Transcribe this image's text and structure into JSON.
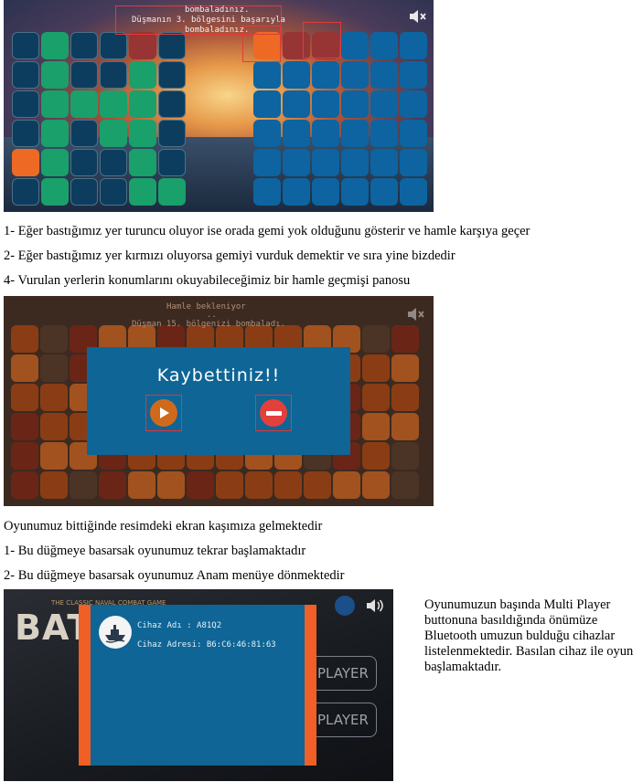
{
  "shot1": {
    "status_lines": [
      "bombaladınız.",
      "Düşmanın 3. bölgesini başarıyla",
      "bombaladınız."
    ],
    "mute_icon": "mute-icon",
    "left_board": [
      [
        "dk",
        "gr",
        "dk",
        "dk",
        "rd",
        "dk"
      ],
      [
        "dk",
        "gr",
        "dk",
        "dk",
        "gr",
        "dk"
      ],
      [
        "dk",
        "gr",
        "gr",
        "gr",
        "gr",
        "dk"
      ],
      [
        "dk",
        "gr",
        "dk",
        "gr",
        "gr",
        "dk"
      ],
      [
        "or",
        "gr",
        "dk",
        "dk",
        "gr",
        "dk"
      ],
      [
        "dk",
        "gr",
        "dk",
        "dk",
        "gr",
        "gr"
      ]
    ],
    "right_board": [
      [
        "or",
        "rd",
        "rd",
        "bl",
        "bl",
        "bl"
      ],
      [
        "bl",
        "bl",
        "bl",
        "bl",
        "bl",
        "bl"
      ],
      [
        "bl",
        "bl",
        "bl",
        "bl",
        "bl",
        "bl"
      ],
      [
        "bl",
        "bl",
        "bl",
        "bl",
        "bl",
        "bl"
      ],
      [
        "bl",
        "bl",
        "bl",
        "bl",
        "bl",
        "bl"
      ],
      [
        "bl",
        "bl",
        "bl",
        "bl",
        "bl",
        "bl"
      ]
    ]
  },
  "captions1": [
    "1- Eğer bastığımız yer turuncu oluyor ise orada gemi yok olduğunu gösterir ve hamle karşıya geçer",
    "2- Eğer bastığımız yer kırmızı oluyorsa gemiyi vurduk demektir ve sıra yine bizdedir",
    "4- Vurulan yerlerin konumlarını okuyabileceğimiz bir hamle geçmişi panosu"
  ],
  "shot2": {
    "waiting_text": "Hamle bekleniyor",
    "dots_text": "..",
    "enemy_text": "Düşman 15. bölgenizi bombaladı.",
    "dialog_title": "Kaybettiniz!!",
    "play_icon": "play-icon",
    "exit_icon": "no-entry-icon"
  },
  "captions2": [
    "Oyunumuz bittiğinde resimdeki ekran kaşımıza gelmektedir",
    "1- Bu düğmeye basarsak oyunumuz tekrar başlamaktadır",
    "2- Bu düğmeye basarsak oyunumuz Anam menüye dönmektedir"
  ],
  "shot3": {
    "logo_text": "BATT",
    "tagline": "THE CLASSIC NAVAL COMBAT GAME",
    "menu_button_1": "PLAYER",
    "menu_button_2": "PLAYER",
    "device_name": "Cihaz Adı  :  A81Q2",
    "device_address": "Cihaz Adresi:  B6:C6:46:81:63",
    "ship_icon": "ship-icon",
    "sound_icon": "speaker-icon"
  },
  "side_text": "Oyunumuzun başında Multi Player buttonuna basıldığında önümüze Bluetooth umuzun bulduğu cihazlar listelenmektedir. Basılan cihaz ile oyun başlamaktadır.",
  "colors": {
    "orange": "#ee6a24",
    "red": "#963534",
    "green": "#1aa06b",
    "blue": "#0d64a0",
    "dark": "#0c3d5e",
    "dialog": "#0e6596"
  }
}
